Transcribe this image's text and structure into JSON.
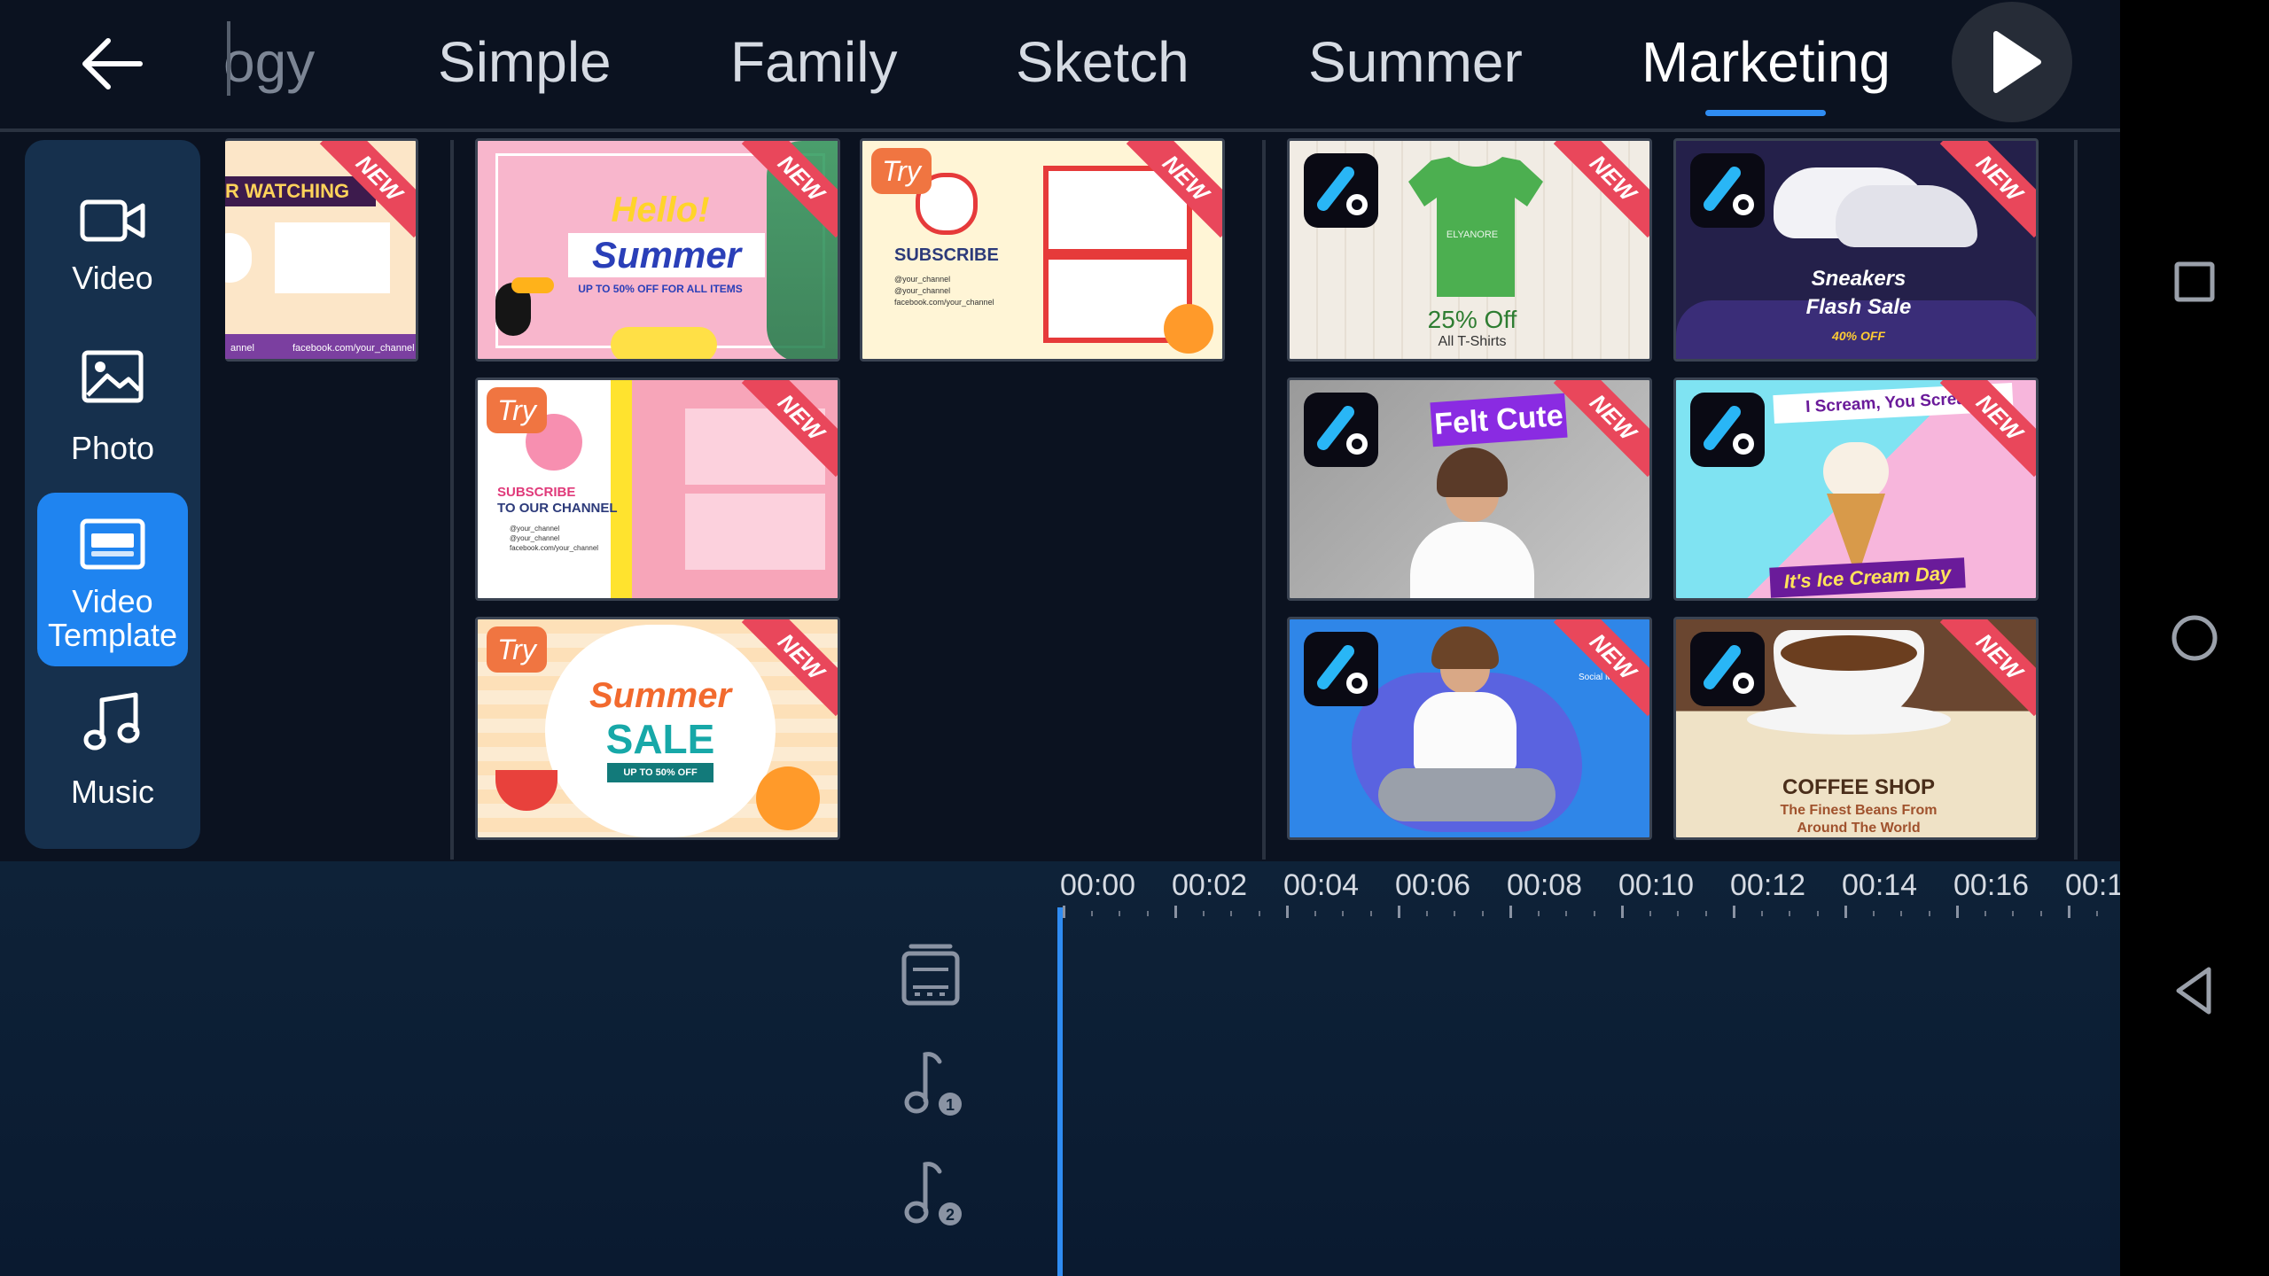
{
  "top_bar": {
    "back_icon": "arrow-left-icon",
    "tabs": [
      {
        "label": "ogy",
        "active": false
      },
      {
        "label": "Simple",
        "active": false
      },
      {
        "label": "Family",
        "active": false
      },
      {
        "label": "Sketch",
        "active": false
      },
      {
        "label": "Summer",
        "active": false
      },
      {
        "label": "Marketing",
        "active": true
      }
    ],
    "play_icon": "play-icon",
    "accent_color": "#2f8cf2"
  },
  "sidebar": {
    "items": [
      {
        "label": "Video",
        "icon": "video-camera-icon",
        "active": false
      },
      {
        "label": "Photo",
        "icon": "photo-icon",
        "active": false
      },
      {
        "label": "Video Template",
        "label_line1": "Video",
        "label_line2": "Template",
        "icon": "video-template-icon",
        "active": true
      },
      {
        "label": "Music",
        "icon": "music-note-icon",
        "active": false
      }
    ]
  },
  "templates": {
    "new_label": "NEW",
    "try_label": "Try",
    "partial": {
      "text1": "R WATCHING",
      "text2": "facebook.com/your_channel",
      "text3": "annel"
    },
    "summer_hello": {
      "line1": "Hello!",
      "line2": "Summer",
      "line3": "UP TO 50% OFF FOR ALL ITEMS"
    },
    "subscribe_frames": {
      "title": "SUBSCRIBE",
      "l1": "@your_channel",
      "l2": "@your_channel",
      "l3": "facebook.com/your_channel"
    },
    "subscribe_channel": {
      "title1": "SUBSCRIBE",
      "title2": "TO OUR CHANNEL",
      "l1": "@your_channel",
      "l2": "@your_channel",
      "l3": "facebook.com/your_channel"
    },
    "summer_sale": {
      "line1": "Summer",
      "line2": "SALE",
      "line3": "UP TO 50% OFF"
    },
    "tshirt": {
      "brand": "ELYANORE",
      "offer": "25% Off",
      "sub": "All T-Shirts"
    },
    "sneakers": {
      "line1": "Sneakers",
      "line2": "Flash Sale",
      "line3": "40% OFF"
    },
    "felt_cute": {
      "title": "Felt Cute"
    },
    "ice_cream": {
      "top": "I Scream, You Scream",
      "bottom": "It's Ice Cream Day"
    },
    "social": {
      "tag": "Social Media"
    },
    "coffee": {
      "title": "COFFEE SHOP",
      "sub1": "The Finest Beans From",
      "sub2": "Around The World"
    }
  },
  "timeline": {
    "ticks": [
      "00:00",
      "00:02",
      "00:04",
      "00:06",
      "00:08",
      "00:10",
      "00:12",
      "00:14",
      "00:16",
      "00:1"
    ],
    "track_icons": [
      "video-track-icon",
      "music-track-1-icon",
      "music-track-2-icon"
    ],
    "track_badges": [
      "1",
      "2"
    ]
  },
  "system_nav": {
    "icons": [
      "recents-square-icon",
      "home-circle-icon",
      "back-triangle-icon"
    ]
  }
}
